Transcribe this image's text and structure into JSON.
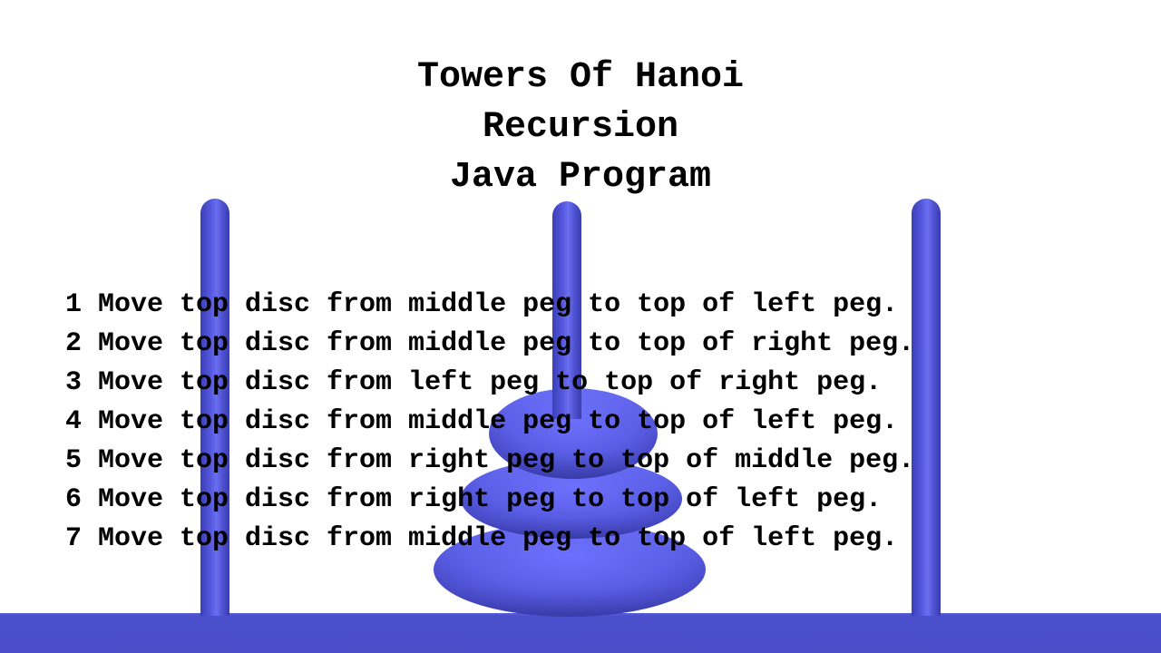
{
  "title": {
    "line1": "Towers Of Hanoi",
    "line2": "Recursion",
    "line3": "Java Program"
  },
  "moves": [
    "1 Move top disc from middle peg to top of left peg.",
    "2 Move top disc from middle peg to top of right peg.",
    "3 Move top disc from left peg to top of right peg.",
    "4 Move top disc from middle peg to top of left peg.",
    "5 Move top disc from right peg to top of middle peg.",
    "6 Move top disc from right peg to top of left peg.",
    "7 Move top disc from middle peg to top of left peg."
  ],
  "colors": {
    "peg": "#5558dd",
    "disc": "#5a5ee6",
    "base": "#4b4ec9",
    "text": "#000000",
    "background": "#ffffff"
  }
}
